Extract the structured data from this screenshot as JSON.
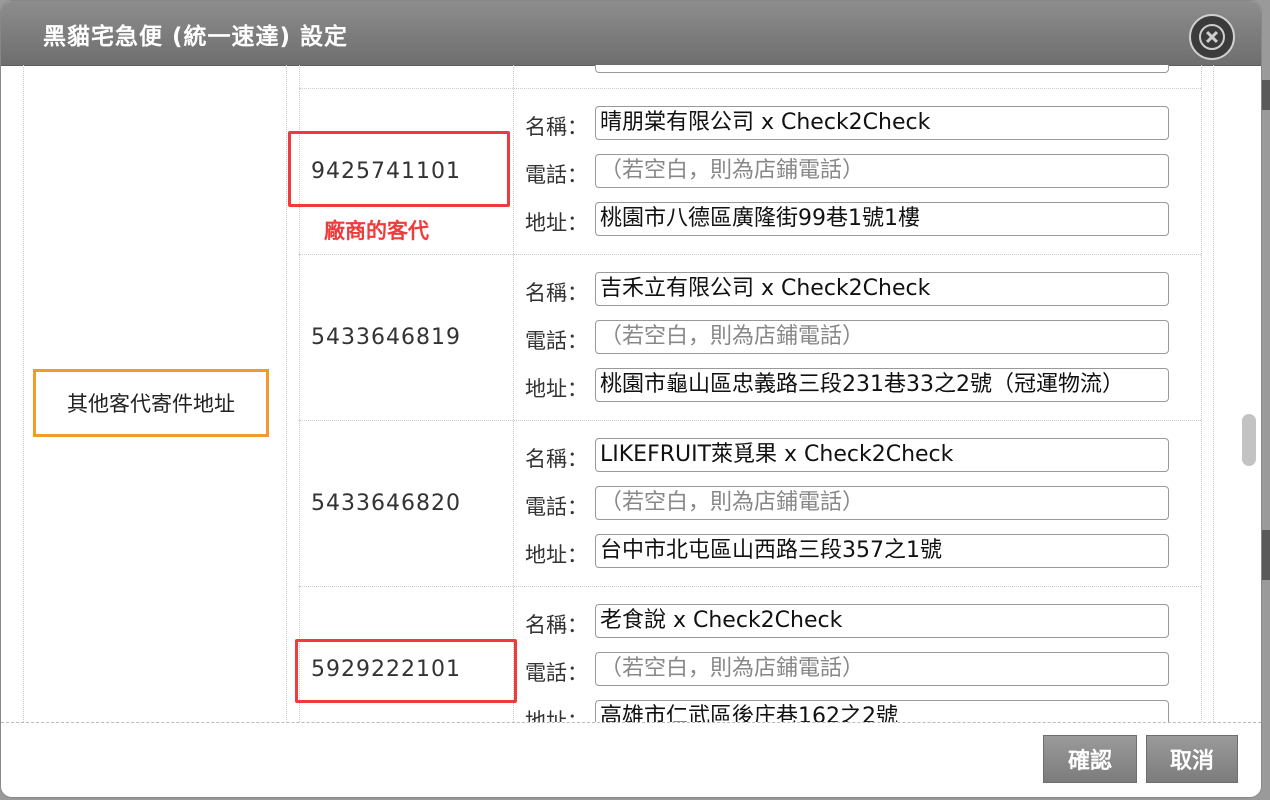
{
  "dialog": {
    "title": "黑貓宅急便 (統一速達) 設定",
    "close_icon": "close-circle-icon"
  },
  "section": {
    "label": "其他客代寄件地址"
  },
  "labels": {
    "name": "名稱：",
    "phone": "電話：",
    "address": "地址："
  },
  "rows": [
    {
      "code": "9425741101",
      "name": "晴朋棠有限公司 x Check2Check",
      "phone_placeholder": "（若空白，則為店鋪電話）",
      "address": "桃園市八德區廣隆街99巷1號1樓",
      "note": "廠商的客代"
    },
    {
      "code": "5433646819",
      "name": "吉禾立有限公司 x Check2Check",
      "phone_placeholder": "（若空白，則為店鋪電話）",
      "address": "桃園市龜山區忠義路三段231巷33之2號（冠運物流）"
    },
    {
      "code": "5433646820",
      "name": "LIKEFRUIT萊覓果 x Check2Check",
      "phone_placeholder": "（若空白，則為店鋪電話）",
      "address": "台中市北屯區山西路三段357之1號"
    },
    {
      "code": "5929222101",
      "name": "老食說 x Check2Check",
      "phone_placeholder": "（若空白，則為店鋪電話）",
      "address": "高雄市仁武區後庄巷162之2號"
    }
  ],
  "footer": {
    "confirm": "確認",
    "cancel": "取消"
  },
  "colors": {
    "highlight_red": "#ef3b3b",
    "highlight_orange": "#f39a2c"
  }
}
